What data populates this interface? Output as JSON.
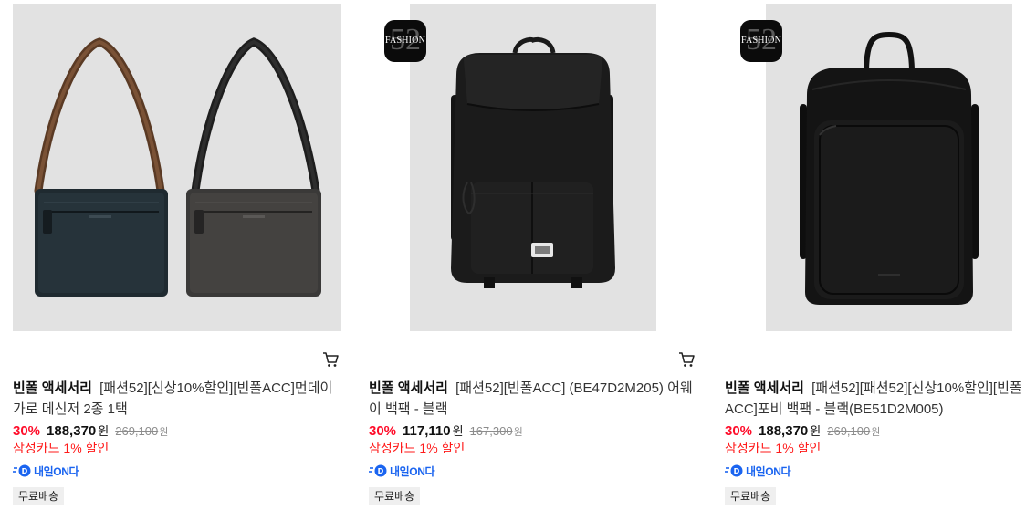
{
  "products": [
    {
      "brand": "빈폴 액세서리",
      "name": "[패션52][신상10%할인][빈폴ACC]먼데이가로 메신저 2종 1택",
      "discount": "30%",
      "price": "188,370",
      "currency": "원",
      "original_price": "269,100",
      "card_promo": "삼성카드 1% 할인",
      "delivery_label": "내일ON다",
      "shipping": "무료배송",
      "has_fashion_badge": false,
      "cart_icon": "cart-icon"
    },
    {
      "brand": "빈폴 액세서리",
      "name": "[패션52][빈폴ACC] (BE47D2M205) 어웨이 백팩 - 블랙",
      "discount": "30%",
      "price": "117,110",
      "currency": "원",
      "original_price": "167,300",
      "card_promo": "삼성카드 1% 할인",
      "delivery_label": "내일ON다",
      "shipping": "무료배송",
      "has_fashion_badge": true,
      "badge_text": "FASHION",
      "badge_number": "52",
      "cart_icon": "cart-icon"
    },
    {
      "brand": "빈폴 액세서리",
      "name": "[패션52][패션52][신상10%할인][빈폴ACC]포비 백팩 - 블랙(BE51D2M005)",
      "discount": "30%",
      "price": "188,370",
      "currency": "원",
      "original_price": "269,100",
      "card_promo": "삼성카드 1% 할인",
      "delivery_label": "내일ON다",
      "shipping": "무료배송",
      "has_fashion_badge": true,
      "badge_text": "FASHION",
      "badge_number": "52",
      "cart_icon": null
    }
  ],
  "colors": {
    "discount_red": "#ff0d2a",
    "promo_red": "#ff1a1a",
    "delivery_blue": "#1a64f0",
    "image_bg": "#e2e2e2"
  }
}
